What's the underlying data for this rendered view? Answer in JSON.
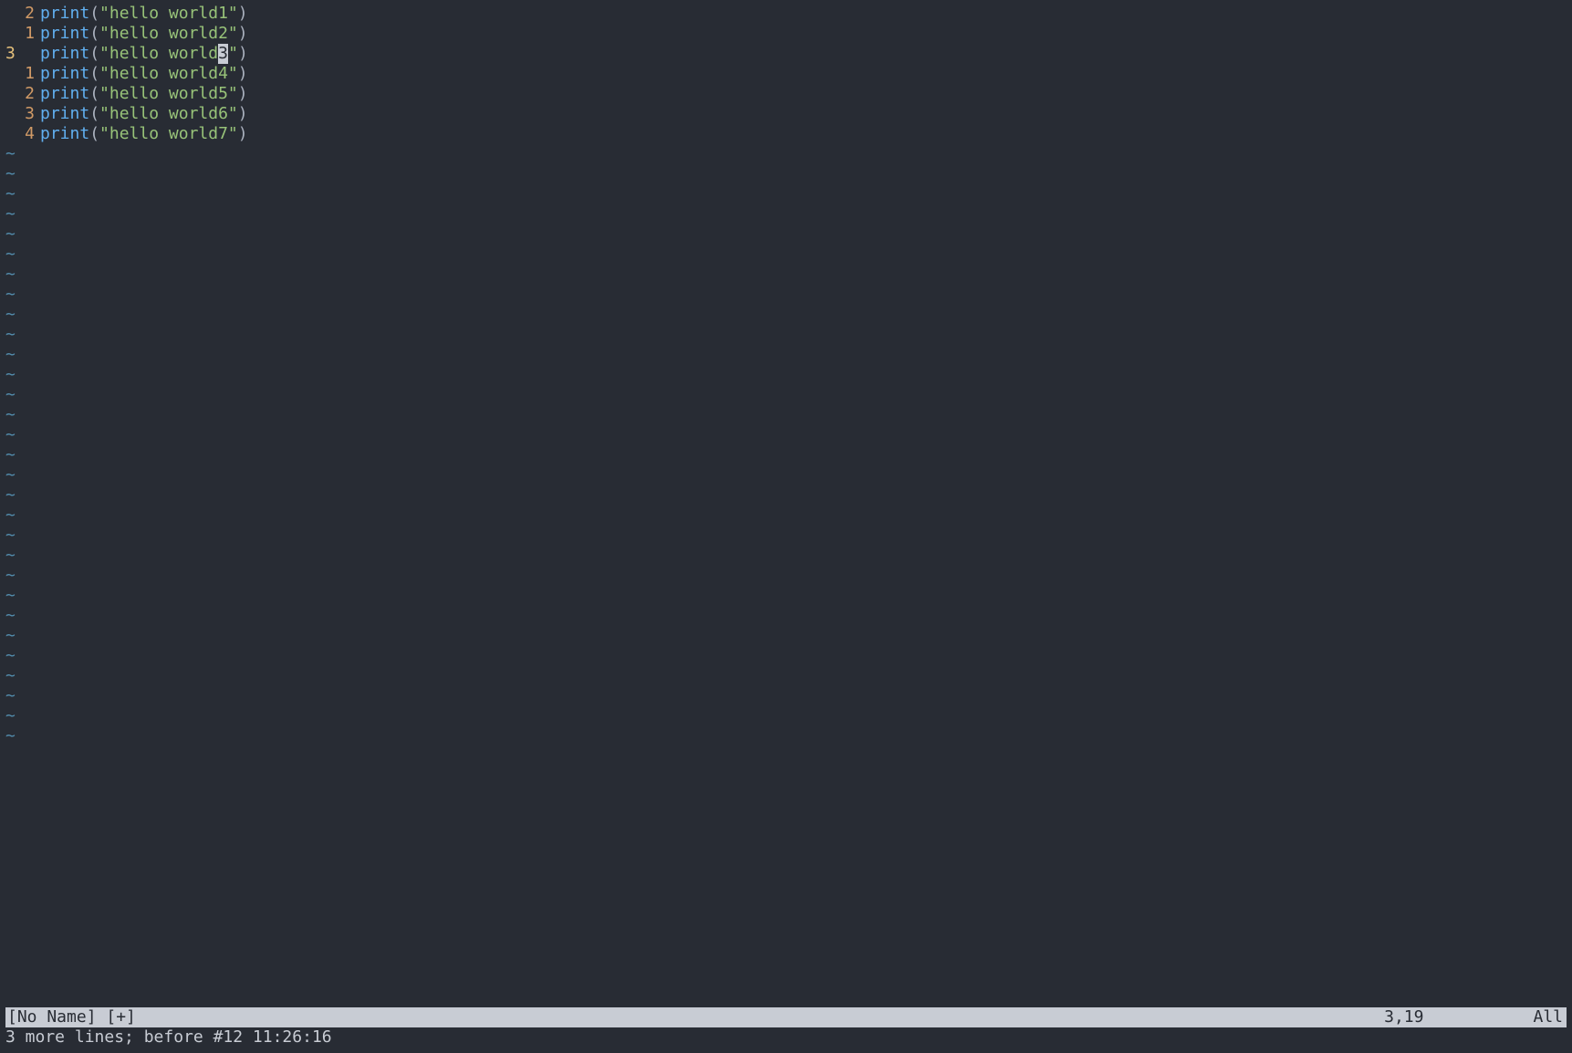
{
  "editor": {
    "lines": [
      {
        "gutter": "2",
        "current": false,
        "pre": "print",
        "open": "(",
        "q1": "\"",
        "mid": "hello world1",
        "q2": "\"",
        "close": ")",
        "cursor_at": -1
      },
      {
        "gutter": "1",
        "current": false,
        "pre": "print",
        "open": "(",
        "q1": "\"",
        "mid": "hello world2",
        "q2": "\"",
        "close": ")",
        "cursor_at": -1
      },
      {
        "gutter": "3",
        "current": true,
        "pre": "print",
        "open": "(",
        "q1": "\"",
        "mid": "hello world3",
        "q2": "\"",
        "close": ")",
        "cursor_at": 11
      },
      {
        "gutter": "1",
        "current": false,
        "pre": "print",
        "open": "(",
        "q1": "\"",
        "mid": "hello world4",
        "q2": "\"",
        "close": ")",
        "cursor_at": -1
      },
      {
        "gutter": "2",
        "current": false,
        "pre": "print",
        "open": "(",
        "q1": "\"",
        "mid": "hello world5",
        "q2": "\"",
        "close": ")",
        "cursor_at": -1
      },
      {
        "gutter": "3",
        "current": false,
        "pre": "print",
        "open": "(",
        "q1": "\"",
        "mid": "hello world6",
        "q2": "\"",
        "close": ")",
        "cursor_at": -1
      },
      {
        "gutter": "4",
        "current": false,
        "pre": "print",
        "open": "(",
        "q1": "\"",
        "mid": "hello world7",
        "q2": "\"",
        "close": ")",
        "cursor_at": -1
      }
    ],
    "tilde_count": 30
  },
  "status": {
    "left": "[No Name] [+]",
    "pos": "3,19",
    "pct": "All"
  },
  "cmdline": "3 more lines; before #12  11:26:16"
}
